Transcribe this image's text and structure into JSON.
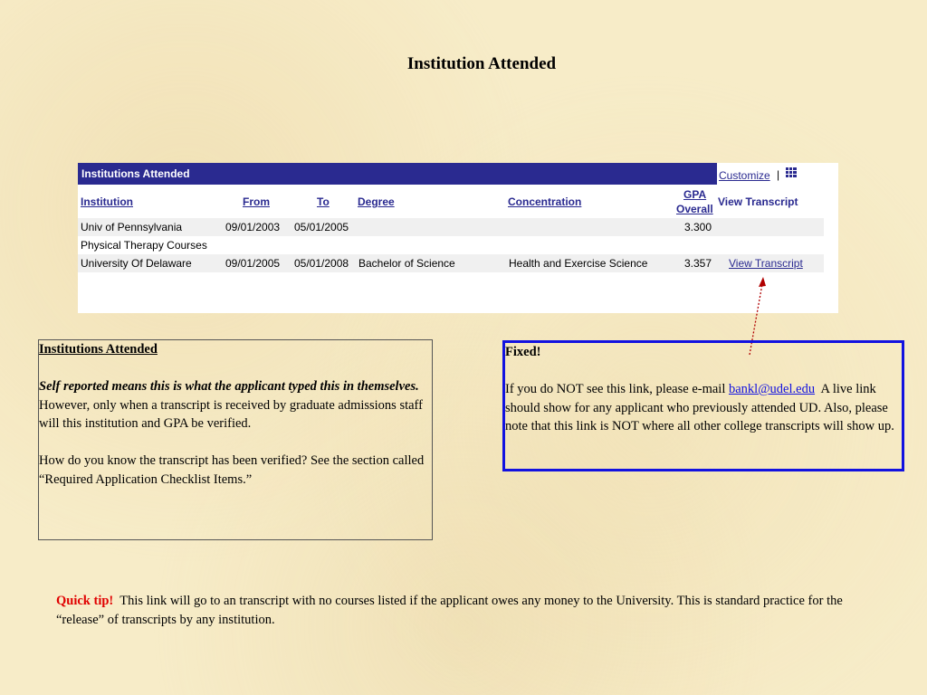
{
  "page": {
    "title": "Institution Attended"
  },
  "grid": {
    "title": "Institutions Attended",
    "customize_label": "Customize",
    "separator": "|",
    "columns": {
      "institution": "Institution",
      "from": "From",
      "to": "To",
      "degree": "Degree",
      "concentration": "Concentration",
      "gpa_line1": "GPA",
      "gpa_line2": "Overall",
      "view_transcript": "View Transcript"
    },
    "rows": [
      {
        "institution": "Univ of Pennsylvania",
        "from": "09/01/2003",
        "to": "05/01/2005",
        "degree": "",
        "concentration": "",
        "gpa": "3.300",
        "link": ""
      },
      {
        "institution": "Physical Therapy Courses",
        "from": "",
        "to": "",
        "degree": "",
        "concentration": "",
        "gpa": "",
        "link": ""
      },
      {
        "institution": "University Of Delaware",
        "from": "09/01/2005",
        "to": "05/01/2008",
        "degree": "Bachelor of Science",
        "concentration": "Health and Exercise Science",
        "gpa": "3.357",
        "link": "View Transcript"
      }
    ]
  },
  "left_note": {
    "heading": "Institutions Attended",
    "italic": "Self reported means this is what the applicant typed this in themselves.",
    "body1": "However, only when a transcript is received by graduate admissions staff will this institution and GPA be verified.",
    "body2": "How do you know the transcript has been verified?  See the section called “Required Application Checklist Items.”"
  },
  "right_note": {
    "heading": "Fixed!",
    "text_before": "If you do NOT see this link, please e-mail",
    "email": "bankl@udel.edu",
    "text_after": "A live link should show for any applicant who previously attended UD.  Also, please note that this link is NOT where all other college transcripts will show up."
  },
  "tip": {
    "label": "Quick tip!",
    "text": "This link will go to an transcript with no courses listed if the applicant owes any money to the University.  This is standard practice for the “release” of transcripts by any institution."
  },
  "colors": {
    "grid_header": "#2a2a90",
    "border_blue": "#1212e0",
    "tip_red": "#e00000",
    "arrow": "#b00000"
  }
}
